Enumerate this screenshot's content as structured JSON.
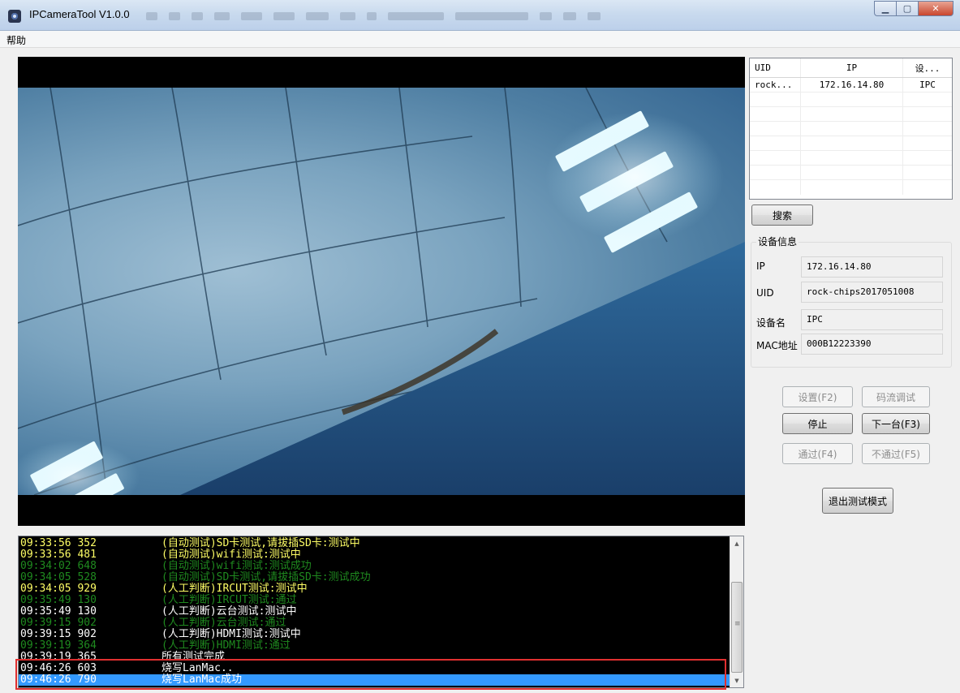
{
  "window": {
    "title": "IPCameraTool V1.0.0"
  },
  "menu": {
    "help": "帮助"
  },
  "device_table": {
    "columns": [
      "UID",
      "IP",
      "设..."
    ],
    "rows": [
      {
        "uid": "rock...",
        "ip": "172.16.14.80",
        "type": "IPC"
      }
    ]
  },
  "buttons": {
    "search": "搜索",
    "settings": "设置(F2)",
    "stream_debug": "码流调试",
    "stop": "停止",
    "next": "下一台(F3)",
    "pass": "通过(F4)",
    "fail": "不通过(F5)",
    "exit_test": "退出测试模式"
  },
  "device_info": {
    "title": "设备信息",
    "ip_label": "IP",
    "ip": "172.16.14.80",
    "uid_label": "UID",
    "uid": "rock-chips2017051008",
    "name_label": "设备名",
    "name": "IPC",
    "mac_label": "MAC地址",
    "mac": "000B12223390"
  },
  "log": [
    {
      "time": "09:33:56 352",
      "msg": "(自动测试)SD卡测试,请拔插SD卡:测试中",
      "color": "#ffff66"
    },
    {
      "time": "09:33:56 481",
      "msg": "(自动测试)wifi测试:测试中",
      "color": "#ffff66"
    },
    {
      "time": "09:34:02 648",
      "msg": "(自动测试)wifi测试:测试成功",
      "color": "#1f8a1f"
    },
    {
      "time": "09:34:05 528",
      "msg": "(自动测试)SD卡测试,请拔插SD卡:测试成功",
      "color": "#1f8a1f"
    },
    {
      "time": "09:34:05 929",
      "msg": "(人工判断)IRCUT测试:测试中",
      "color": "#ffff66"
    },
    {
      "time": "09:35:49 130",
      "msg": "(人工判断)IRCUT测试:通过",
      "color": "#1f8a1f"
    },
    {
      "time": "09:35:49 130",
      "msg": "(人工判断)云台测试:测试中",
      "color": "#ffffff"
    },
    {
      "time": "09:39:15 902",
      "msg": "(人工判断)云台测试:通过",
      "color": "#1f8a1f"
    },
    {
      "time": "09:39:15 902",
      "msg": "(人工判断)HDMI测试:测试中",
      "color": "#ffffff"
    },
    {
      "time": "09:39:19 364",
      "msg": "(人工判断)HDMI测试:通过",
      "color": "#1f8a1f"
    },
    {
      "time": "09:39:19 365",
      "msg": "所有测试完成",
      "color": "#ffffff"
    },
    {
      "time": "09:46:26 603",
      "msg": "烧写LanMac..",
      "color": "#ffffff"
    },
    {
      "time": "09:46:26 790",
      "msg": "烧写LanMac成功",
      "color": "#ffffff",
      "selected": true
    }
  ]
}
